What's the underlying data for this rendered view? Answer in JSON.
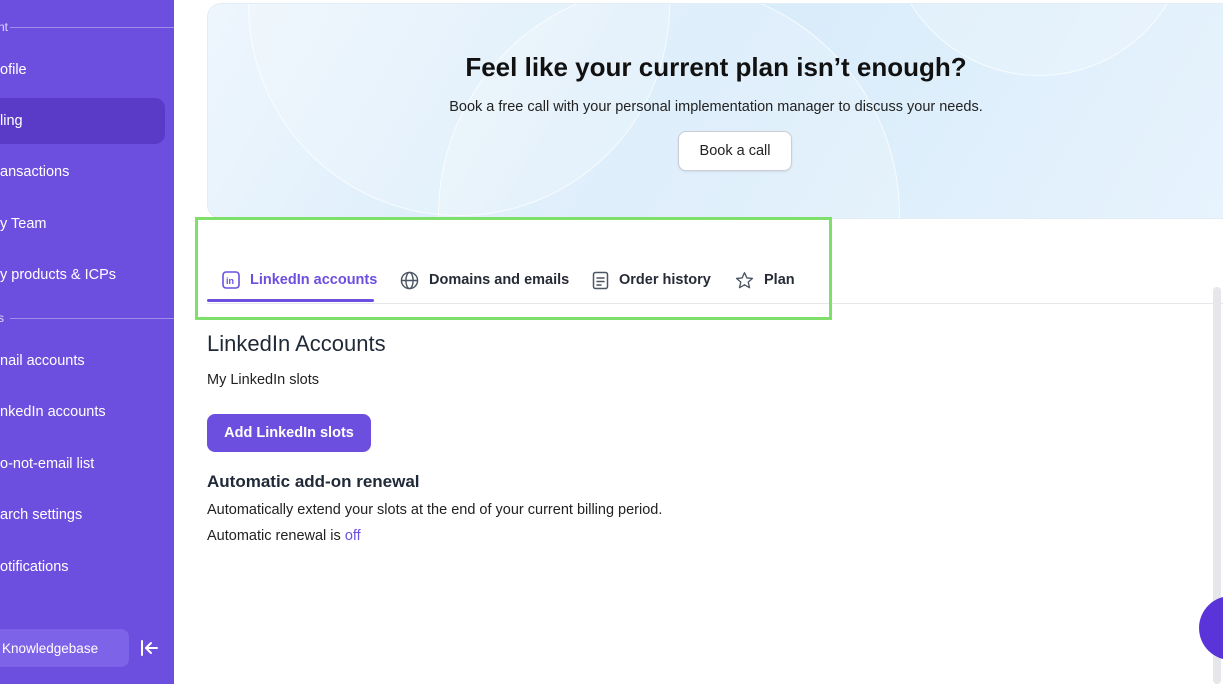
{
  "sidebar": {
    "section_top": "nt",
    "items_account": [
      {
        "label": "ofile",
        "active": false
      },
      {
        "label": "ling",
        "active": true
      },
      {
        "label": "ansactions",
        "active": false
      },
      {
        "label": "y Team",
        "active": false
      },
      {
        "label": "y products & ICPs",
        "active": false
      }
    ],
    "section_settings": "s",
    "items_settings": [
      {
        "label": "nail accounts"
      },
      {
        "label": "nkedIn accounts"
      },
      {
        "label": "o-not-email list"
      },
      {
        "label": "arch settings"
      },
      {
        "label": "otifications"
      }
    ],
    "knowledgebase_label": "Knowledgebase",
    "collapse_icon": "collapse-left-icon",
    "color": "#6d4fe0"
  },
  "banner": {
    "title": "Feel like your current plan isn’t enough?",
    "subtitle": "Book a free call with your personal implementation manager to discuss your needs.",
    "button": "Book a call"
  },
  "tabs": [
    {
      "label": "LinkedIn accounts",
      "icon": "linkedin-icon",
      "active": true
    },
    {
      "label": "Domains and emails",
      "icon": "globe-icon",
      "active": false
    },
    {
      "label": "Order history",
      "icon": "document-icon",
      "active": false
    },
    {
      "label": "Plan",
      "icon": "star-icon",
      "active": false
    }
  ],
  "content": {
    "heading": "LinkedIn Accounts",
    "slots_label": "My LinkedIn slots",
    "add_button": "Add LinkedIn slots",
    "renewal_heading": "Automatic add-on renewal",
    "renewal_description": "Automatically extend your slots at the end of your current billing period.",
    "renewal_status_prefix": "Automatic renewal is",
    "renewal_status_value": "off"
  },
  "colors": {
    "accent": "#6d4fe0",
    "highlight": "#7ee06a"
  }
}
